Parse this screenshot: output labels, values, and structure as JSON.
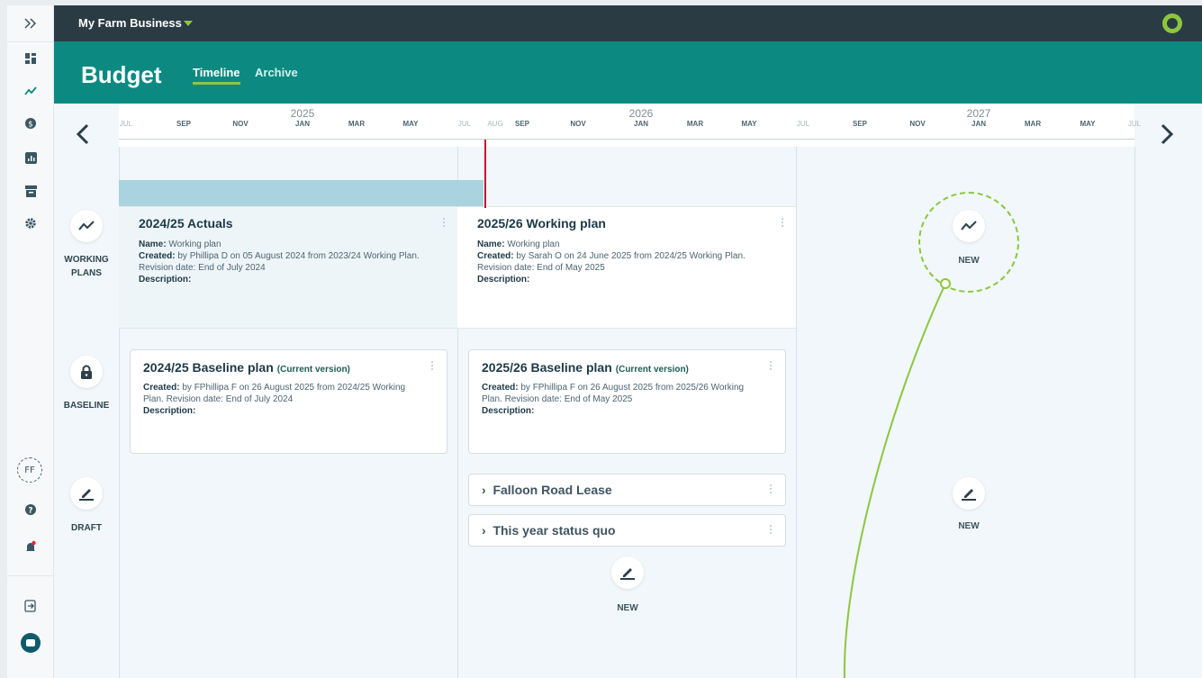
{
  "app": {
    "business_name": "My Farm Business",
    "page_title": "Budget",
    "tabs": [
      {
        "label": "Timeline",
        "active": true
      },
      {
        "label": "Archive",
        "active": false
      }
    ]
  },
  "sidebar": {
    "expand_icon": "chevrons-right-icon",
    "items": [
      {
        "icon": "dashboard-icon"
      },
      {
        "icon": "trend-icon",
        "active": true
      },
      {
        "icon": "dollar-icon"
      },
      {
        "icon": "bar-chart-icon"
      },
      {
        "icon": "archive-icon"
      },
      {
        "icon": "gear-icon"
      }
    ],
    "avatar_initials": "FF",
    "bottom": [
      {
        "icon": "help-icon"
      },
      {
        "icon": "bell-icon"
      },
      {
        "icon": "logout-icon"
      },
      {
        "icon": "chat-icon"
      }
    ]
  },
  "ruler": {
    "years": [
      "2025",
      "2026",
      "2027"
    ],
    "months_first": [
      "JUL",
      "SEP",
      "NOV",
      "JAN",
      "MAR",
      "MAY"
    ],
    "months_second": [
      "JUL",
      "AUG",
      "SEP",
      "NOV",
      "JAN",
      "MAR",
      "MAY"
    ],
    "months_third": [
      "JUL",
      "SEP",
      "NOV",
      "JAN",
      "MAR",
      "MAY",
      "JUL"
    ]
  },
  "rows": {
    "working_plans": "WORKING\nPLANS",
    "baseline": "BASELINE",
    "draft": "DRAFT"
  },
  "cards": {
    "actuals": {
      "title": "2024/25 Actuals",
      "name_label": "Name:",
      "name_value": "Working plan",
      "created_label": "Created:",
      "created_value": "by Phillipa D on 05 August 2024 from 2023/24 Working Plan. Revision date: End of July 2024",
      "description_label": "Description:"
    },
    "working_plan": {
      "title": "2025/26 Working plan",
      "name_label": "Name:",
      "name_value": "Working plan",
      "created_label": "Created:",
      "created_value": "by Sarah O on 24 June 2025 from 2024/25 Working Plan. Revision date: End of May 2025",
      "description_label": "Description:"
    },
    "baseline_2425": {
      "title": "2024/25 Baseline plan",
      "current_version": "(Current version)",
      "created_label": "Created:",
      "created_value": "by FPhillipa F on 26 August 2025 from 2024/25 Working Plan. Revision date: End of July 2024",
      "description_label": "Description:"
    },
    "baseline_2526": {
      "title": "2025/26 Baseline plan",
      "current_version": "(Current version)",
      "created_label": "Created:",
      "created_value": "by FPhillipa F on 26 August 2025 from 2025/26 Working Plan. Revision date: End of May 2025",
      "description_label": "Description:"
    }
  },
  "drafts": [
    {
      "label": "Falloon Road Lease"
    },
    {
      "label": "This year status quo"
    }
  ],
  "new_label": "NEW",
  "colors": {
    "header": "#0c8a82",
    "topbar": "#2b3b43",
    "accent": "#8cc63f",
    "today_line": "#c8102e",
    "period_bar": "#a9d3df"
  }
}
